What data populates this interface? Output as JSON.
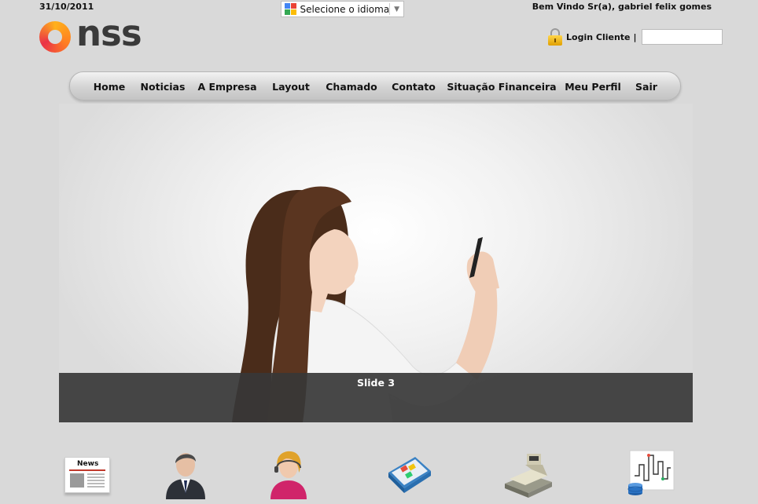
{
  "header": {
    "date": "31/10/2011",
    "language_selector": "Selecione o idioma",
    "welcome": "Bem Vindo Sr(a), gabriel felix gomes"
  },
  "logo": {
    "text": "nss"
  },
  "login": {
    "label": "Login Cliente",
    "separator": "|",
    "value": ""
  },
  "nav": {
    "items": [
      "Home",
      "Noticias",
      "A Empresa",
      "Layout",
      "Chamado",
      "Contato",
      "Situação Financeira",
      "Meu Perfil",
      "Sair"
    ]
  },
  "slider": {
    "caption": "Slide 3"
  },
  "shortcuts": {
    "news_label": "News",
    "icons": [
      "news-icon",
      "businessman-icon",
      "support-agent-icon",
      "software-box-icon",
      "cash-register-icon",
      "chart-database-icon"
    ]
  }
}
